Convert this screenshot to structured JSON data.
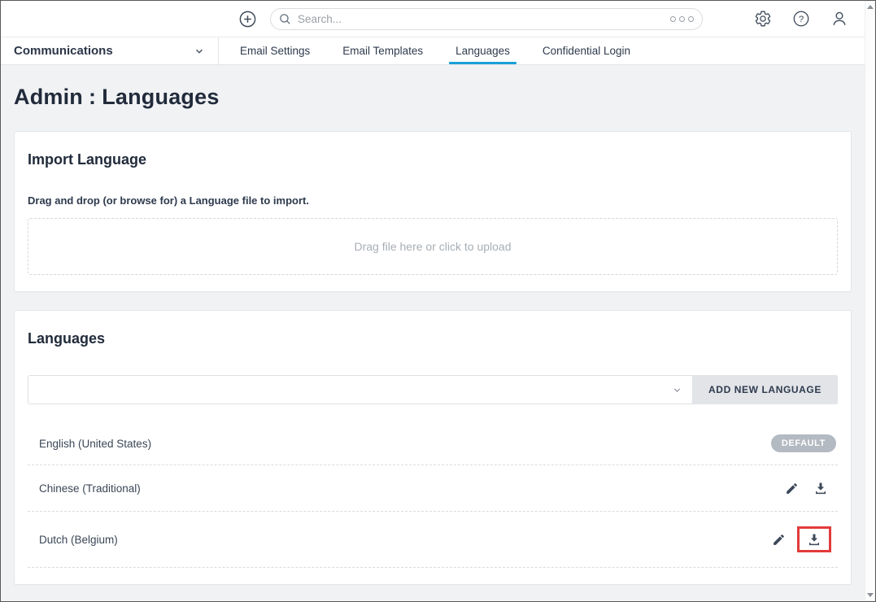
{
  "topbar": {
    "search": {
      "placeholder": "Search..."
    }
  },
  "nav": {
    "module": "Communications",
    "tabs": [
      {
        "label": "Email Settings",
        "active": false
      },
      {
        "label": "Email Templates",
        "active": false
      },
      {
        "label": "Languages",
        "active": true
      },
      {
        "label": "Confidential Login",
        "active": false
      }
    ]
  },
  "page": {
    "title_section": "Admin",
    "title_separator": ":",
    "title_page": "Languages"
  },
  "import_card": {
    "title": "Import Language",
    "instruction": "Drag and drop (or browse for) a Language file to import.",
    "dropzone_label": "Drag file here or click to upload"
  },
  "languages_card": {
    "title": "Languages",
    "select_value": "",
    "add_button_label": "ADD NEW LANGUAGE",
    "rows": [
      {
        "name": "English (United States)",
        "badge": "DEFAULT"
      },
      {
        "name": "Chinese (Traditional)"
      },
      {
        "name": "Dutch (Belgium)"
      }
    ]
  },
  "help_icon_glyph": "?",
  "colors": {
    "accent_blue": "#1a9fd7",
    "badge_gray": "#b3bac1",
    "highlight_red": "#e23b3b"
  }
}
